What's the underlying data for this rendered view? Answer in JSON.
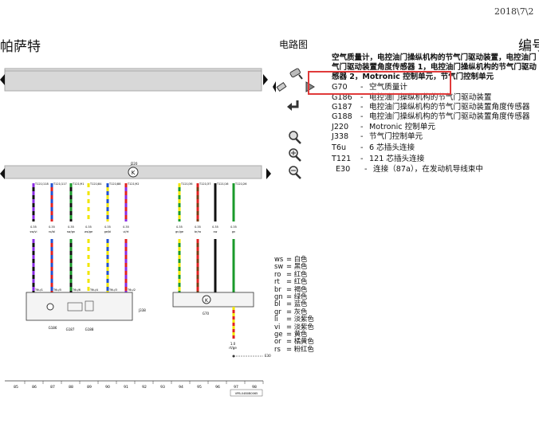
{
  "top_date": "2018\\7\\2",
  "brand_title": "帕萨特",
  "section_title": "电路图",
  "code_title": "编号",
  "header_text": "空气质量计，电控油门操纵机构的节气门驱动装置，电控油门气门驱动装置角度传感器 1，电控油门操纵机构的节气门驱动感器 2，Motronic 控制单元，节气门控制单元",
  "legend": [
    {
      "code": "G70",
      "desc": "空气质量计"
    },
    {
      "code": "G186",
      "desc": "电控油门操纵机构的节气门驱动装置"
    },
    {
      "code": "G187",
      "desc": "电控油门操纵机构的节气门驱动装置角度传感器"
    },
    {
      "code": "G188",
      "desc": "电控油门操纵机构的节气门驱动装置角度传感器"
    },
    {
      "code": "J220",
      "desc": "Motronic 控制单元"
    },
    {
      "code": "J338",
      "desc": "节气门控制单元"
    },
    {
      "code": "T6u",
      "desc": "6 芯插头连接"
    },
    {
      "code": "T121",
      "desc": "121 芯插头连接"
    },
    {
      "code": "E30",
      "desc": "连接（87a），在发动机导线束中"
    }
  ],
  "color_legend": [
    {
      "code": "ws",
      "name": "白色"
    },
    {
      "code": "sw",
      "name": "黑色"
    },
    {
      "code": "ro",
      "name": "红色"
    },
    {
      "code": "rt",
      "name": "红色"
    },
    {
      "code": "br",
      "name": "褐色"
    },
    {
      "code": "gn",
      "name": "绿色"
    },
    {
      "code": "bl",
      "name": "蓝色"
    },
    {
      "code": "gr",
      "name": "灰色"
    },
    {
      "code": "li",
      "name": "淡紫色"
    },
    {
      "code": "vi",
      "name": "淡紫色"
    },
    {
      "code": "ge",
      "name": "黄色"
    },
    {
      "code": "or",
      "name": "橘黄色"
    },
    {
      "code": "rs",
      "name": "粉红色"
    }
  ],
  "diagram": {
    "unit_top_label": "J220",
    "component_labels": [
      "G186",
      "G187",
      "G188",
      "J338",
      "G70"
    ],
    "ground_label": "E30",
    "ground_rating": "1.0",
    "ground_wire_color": "rt/ge",
    "column_numbers": [
      "85",
      "86",
      "87",
      "88",
      "89",
      "90",
      "91",
      "92",
      "93",
      "94",
      "95",
      "96",
      "97",
      "98"
    ],
    "document_number": "VPB-04B0B0065",
    "pins": [
      "T121/118",
      "T121/117",
      "T121/91",
      "T121/84",
      "T121/88",
      "T121/92",
      "T121/36",
      "T121/37",
      "T121/16",
      "T121/26"
    ],
    "wire_sizes": [
      "0.35",
      "0.35",
      "0.35",
      "0.35",
      "0.35",
      "0.35",
      "0.35",
      "0.35",
      "0.35",
      "0.35"
    ],
    "wire_colors": [
      "sw/vi",
      "ro/bl",
      "sw/gn",
      "ws/ge",
      "ge/bl",
      "vi/rt",
      "gn/ge",
      "br/ro",
      "sw",
      "gn"
    ],
    "connectors": [
      "T6u/1",
      "T6u/5",
      "T6u/6",
      "T6u/4",
      "T6u/3",
      "T6u/2"
    ],
    "colors": {
      "red": "#e02020",
      "blue": "#2050d0",
      "green": "#1a9a2a",
      "yellow": "#f2e600",
      "black": "#111111",
      "violet": "#8a2be2",
      "white": "#ffffff",
      "brown": "#7a3b12",
      "highlight": "#e03a3a"
    }
  },
  "icons": [
    "zoom-icon",
    "chevron-left-icon",
    "chevron-right-icon",
    "arrow-return-icon",
    "magnifier-icon",
    "magnifier-plus-icon",
    "magnifier-minus-icon"
  ]
}
